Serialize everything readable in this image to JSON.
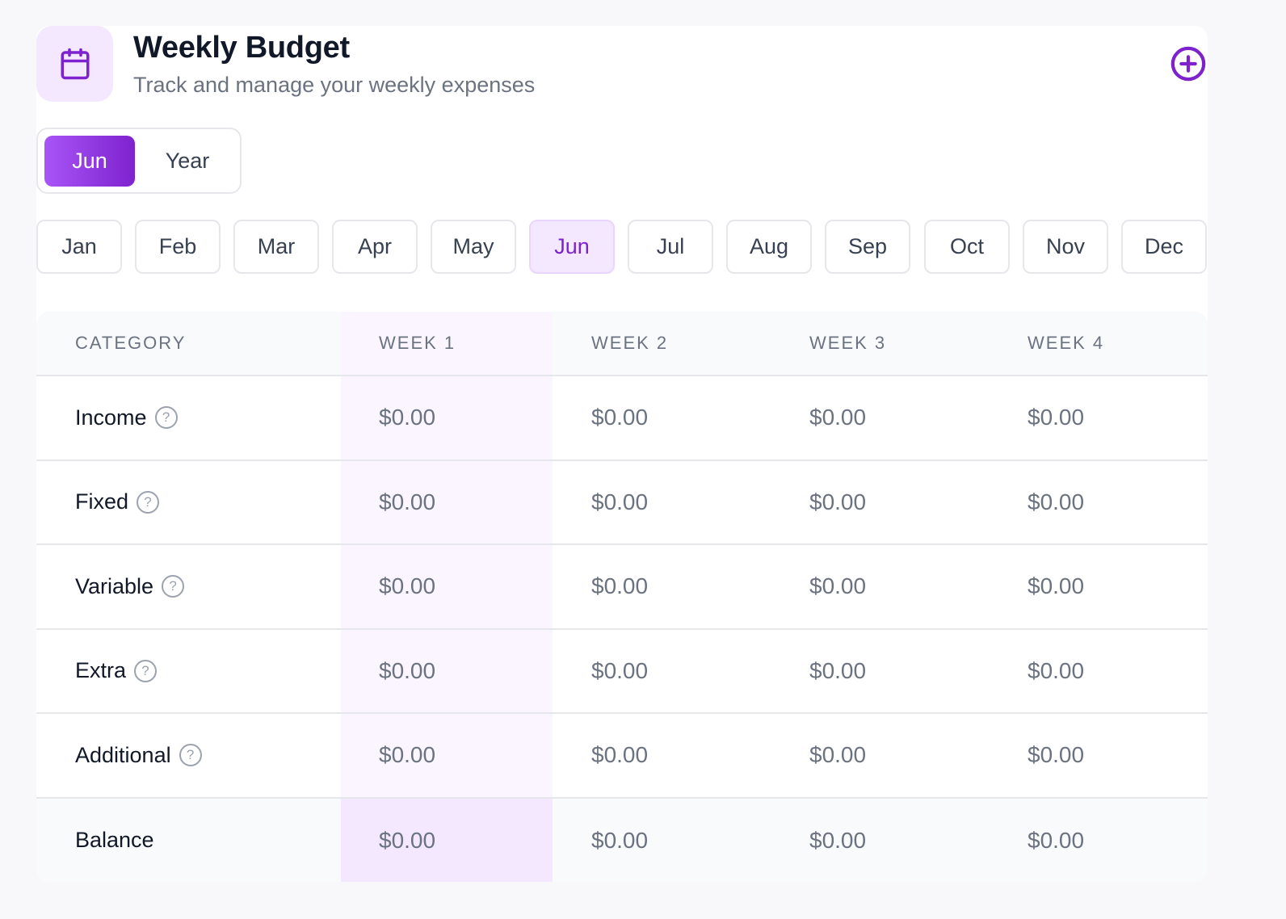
{
  "header": {
    "title": "Weekly Budget",
    "subtitle": "Track and manage your weekly expenses",
    "icon": "calendar-icon",
    "add_icon": "plus-circle-icon"
  },
  "view_toggle": {
    "options": [
      "Jun",
      "Year"
    ],
    "selected": "Jun"
  },
  "months": [
    "Jan",
    "Feb",
    "Mar",
    "Apr",
    "May",
    "Jun",
    "Jul",
    "Aug",
    "Sep",
    "Oct",
    "Nov",
    "Dec"
  ],
  "selected_month": "Jun",
  "table": {
    "headers": [
      "CATEGORY",
      "WEEK 1",
      "WEEK 2",
      "WEEK 3",
      "WEEK 4"
    ],
    "help_glyph": "?",
    "rows": [
      {
        "category": "Income",
        "help": true,
        "values": [
          "$0.00",
          "$0.00",
          "$0.00",
          "$0.00"
        ]
      },
      {
        "category": "Fixed",
        "help": true,
        "values": [
          "$0.00",
          "$0.00",
          "$0.00",
          "$0.00"
        ]
      },
      {
        "category": "Variable",
        "help": true,
        "values": [
          "$0.00",
          "$0.00",
          "$0.00",
          "$0.00"
        ]
      },
      {
        "category": "Extra",
        "help": true,
        "values": [
          "$0.00",
          "$0.00",
          "$0.00",
          "$0.00"
        ]
      },
      {
        "category": "Additional",
        "help": true,
        "values": [
          "$0.00",
          "$0.00",
          "$0.00",
          "$0.00"
        ]
      },
      {
        "category": "Balance",
        "help": false,
        "values": [
          "$0.00",
          "$0.00",
          "$0.00",
          "$0.00"
        ]
      }
    ]
  },
  "colors": {
    "accent": "#7e22ce",
    "accent_light": "#f3e8ff",
    "week_highlight": "#faf5ff"
  }
}
